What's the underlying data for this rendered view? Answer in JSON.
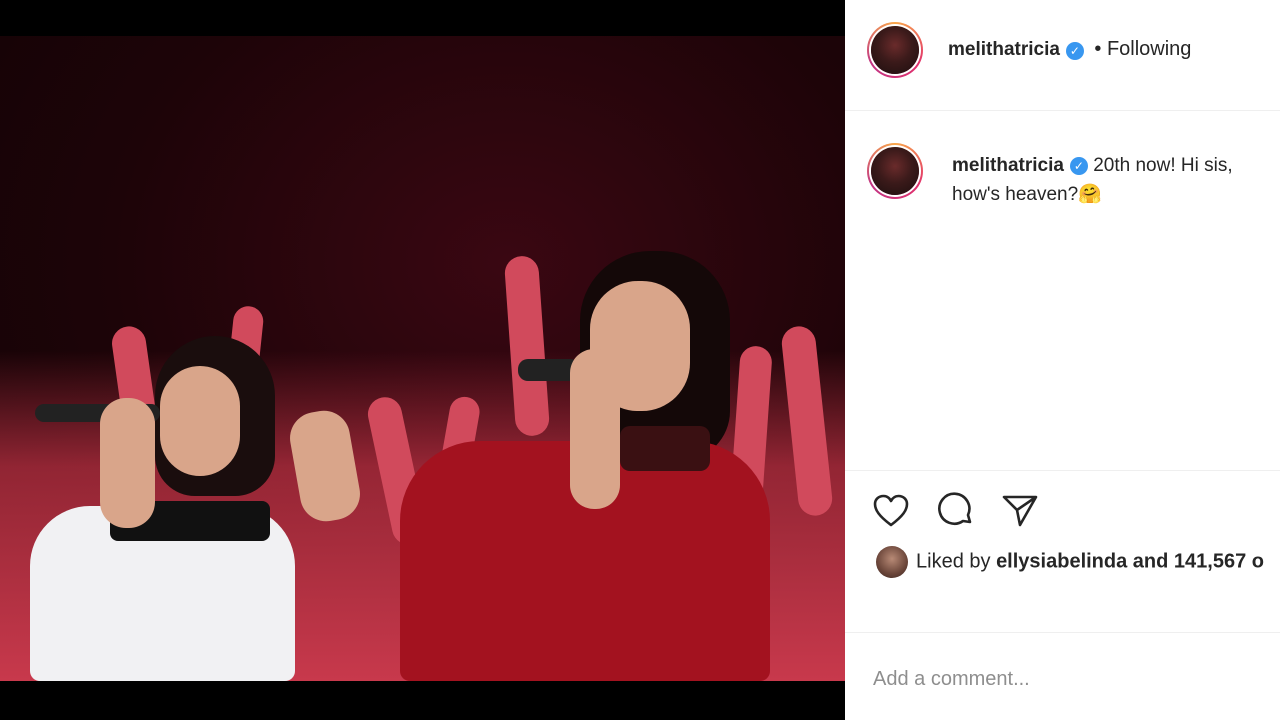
{
  "post": {
    "author": "melithatricia",
    "verified_mark": "✓",
    "following_label": "• Following",
    "caption_user": "melithatricia",
    "caption_text": "20th now! Hi sis, how's heaven?",
    "caption_emoji": "🤗",
    "icons": [
      "heart-icon",
      "comment-icon",
      "share-icon"
    ],
    "likes_prefix": "Liked by",
    "likes_user": "ellysiabelinda",
    "likes_suffix": "and 141,567 o",
    "comment_placeholder": "Add a comment..."
  },
  "colors": {
    "verified": "#3897f0",
    "text": "#262626",
    "muted": "#8e8e8e",
    "story_ring": "#e1306c",
    "photo_red": "#c8394c"
  }
}
